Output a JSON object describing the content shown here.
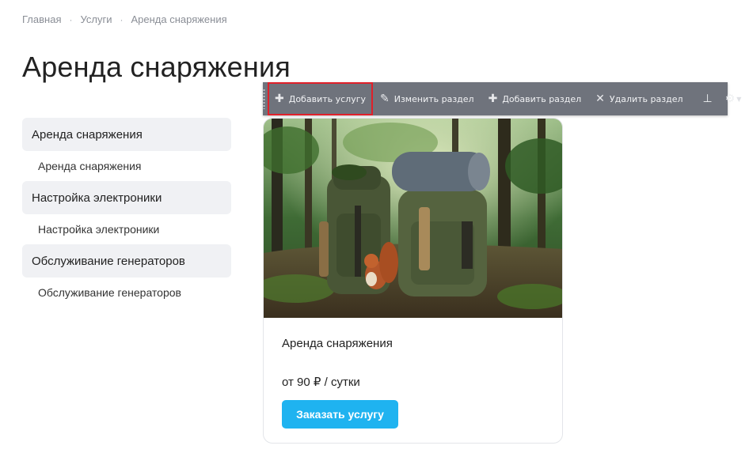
{
  "breadcrumb": {
    "items": [
      "Главная",
      "Услуги",
      "Аренда снаряжения"
    ],
    "separator": "·"
  },
  "page_title": "Аренда снаряжения",
  "sidebar": {
    "groups": [
      {
        "label": "Аренда снаряжения",
        "sub": "Аренда снаряжения"
      },
      {
        "label": "Настройка электроники",
        "sub": "Настройка электроники"
      },
      {
        "label": "Обслуживание генераторов",
        "sub": "Обслуживание генераторов"
      }
    ]
  },
  "toolbar": {
    "add_service": "Добавить услугу",
    "edit_section": "Изменить раздел",
    "add_section": "Добавить раздел",
    "delete_section": "Удалить раздел",
    "icons": {
      "add_service": "plus-icon",
      "edit_section": "pencil-icon",
      "add_section": "plus-icon",
      "delete_section": "x-icon",
      "pin": "pin-icon",
      "settings": "gear-icon",
      "menu_caret": "chevron-down-icon"
    },
    "highlight_color": "#e0202a",
    "bg_color": "#6f737c"
  },
  "card": {
    "image_alt": "backpacks-with-squirrel-photo",
    "title": "Аренда снаряжения",
    "price": "от 90 ₽ / сутки",
    "order_button": "Заказать услугу",
    "button_color": "#1fb3f0"
  }
}
